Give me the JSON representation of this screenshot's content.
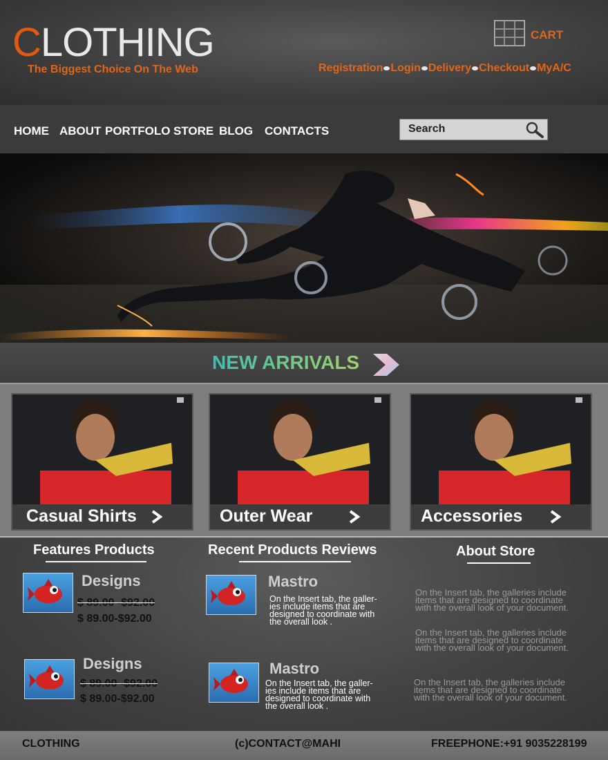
{
  "brand": {
    "logo_first_letter": "C",
    "logo_rest": "LOTHING",
    "tagline": "The Biggest Choice On The Web",
    "accent_color": "#e0661c"
  },
  "header": {
    "cart_label": "CART",
    "links": [
      "Registration",
      "Login",
      "Delivery",
      "Checkout",
      "MyA/C"
    ]
  },
  "nav": {
    "items": [
      "HOME",
      "ABOUT",
      "PORTFOLO",
      "STORE",
      "BLOG",
      "CONTACTS"
    ],
    "search_label": "Search"
  },
  "arrivals": {
    "title": "NEW ARRIVALS"
  },
  "categories": [
    {
      "label": "Casual Shirts"
    },
    {
      "label": "Outer Wear"
    },
    {
      "label": "Accessories"
    }
  ],
  "sections": {
    "features_title": "Features Products",
    "reviews_title": "Recent Products Reviews",
    "about_title": "About Store"
  },
  "features": [
    {
      "name": "Designs",
      "old_price": "$ 89.00 -$92.00",
      "new_price": "$ 89.00-$92.00"
    },
    {
      "name": "Designs",
      "old_price": "$ 89.00 -$92.00 ",
      "new_price": "$ 89.00-$92.00"
    }
  ],
  "reviews": [
    {
      "name": "Mastro",
      "text": "On the Insert tab, the galler-ies include items that are designed to coordinate with the overall look ."
    },
    {
      "name": "Mastro",
      "text": "On the Insert tab, the galler-ies include items that are designed to coordinate with the overall look ."
    }
  ],
  "about": [
    "On the Insert tab, the galleries include items that are designed to coordinate with the overall look of your document.",
    "On the Insert tab, the galleries include items that are designed to coordinate with the overall look of your document.",
    "On the Insert tab, the galleries include items that are designed to coordinate with the overall look of your document."
  ],
  "footer": {
    "brand": "CLOTHING",
    "contact": "(c)CONTACT@MAHI",
    "phone": "FREEPHONE:+91 9035228199"
  }
}
